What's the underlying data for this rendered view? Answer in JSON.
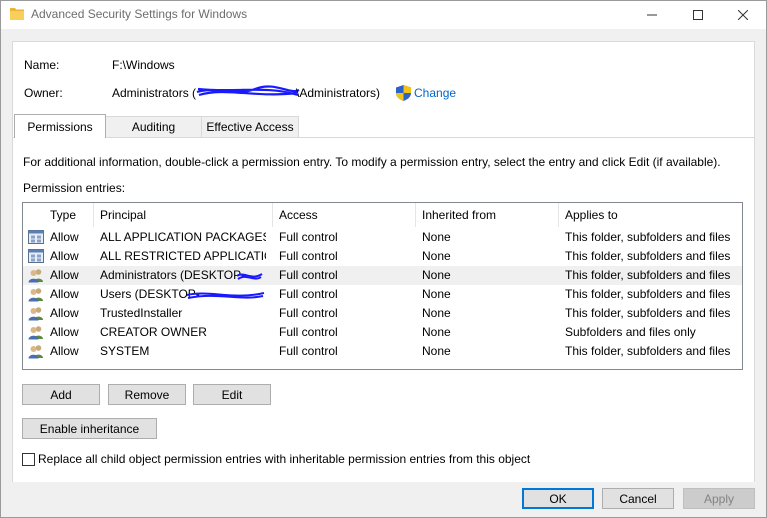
{
  "window": {
    "title": "Advanced Security Settings for Windows"
  },
  "info": {
    "name_label": "Name:",
    "name_value": "F:\\Windows",
    "owner_label": "Owner:",
    "owner_prefix": "Administrators (",
    "owner_suffix": "\\Administrators)",
    "change_link": "Change"
  },
  "tabs": [
    {
      "label": "Permissions",
      "active": true
    },
    {
      "label": "Auditing",
      "active": false
    },
    {
      "label": "Effective Access",
      "active": false
    }
  ],
  "permissions": {
    "info_text": "For additional information, double-click a permission entry. To modify a permission entry, select the entry and click Edit (if available).",
    "entries_label": "Permission entries:",
    "columns": [
      "Type",
      "Principal",
      "Access",
      "Inherited from",
      "Applies to"
    ],
    "rows": [
      {
        "icon": "app-package-icon",
        "type": "Allow",
        "principal": "ALL APPLICATION PACKAGES",
        "access": "Full control",
        "inherited": "None",
        "applies": "This folder, subfolders and files"
      },
      {
        "icon": "app-package-icon",
        "type": "Allow",
        "principal": "ALL RESTRICTED APPLICATIO...",
        "access": "Full control",
        "inherited": "None",
        "applies": "This folder, subfolders and files"
      },
      {
        "icon": "user-group-icon",
        "type": "Allow",
        "principal": "Administrators (DESKTOP-",
        "access": "Full control",
        "inherited": "None",
        "applies": "This folder, subfolders and files"
      },
      {
        "icon": "user-group-icon",
        "type": "Allow",
        "principal": "Users (DESKTOP-",
        "access": "Full control",
        "inherited": "None",
        "applies": "This folder, subfolders and files"
      },
      {
        "icon": "user-group-icon",
        "type": "Allow",
        "principal": "TrustedInstaller",
        "access": "Full control",
        "inherited": "None",
        "applies": "This folder, subfolders and files"
      },
      {
        "icon": "user-group-icon",
        "type": "Allow",
        "principal": "CREATOR OWNER",
        "access": "Full control",
        "inherited": "None",
        "applies": "Subfolders and files only"
      },
      {
        "icon": "user-group-icon",
        "type": "Allow",
        "principal": "SYSTEM",
        "access": "Full control",
        "inherited": "None",
        "applies": "This folder, subfolders and files"
      }
    ],
    "selected_row": 2
  },
  "buttons": {
    "add": "Add",
    "remove": "Remove",
    "edit": "Edit",
    "enable_inheritance": "Enable inheritance",
    "ok": "OK",
    "cancel": "Cancel",
    "apply": "Apply"
  },
  "replace_checkbox": {
    "label": "Replace all child object permission entries with inheritable permission entries from this object",
    "checked": false
  },
  "colors": {
    "accent": "#0078d7",
    "link": "#0066cc",
    "redaction": "#1a1aff"
  }
}
